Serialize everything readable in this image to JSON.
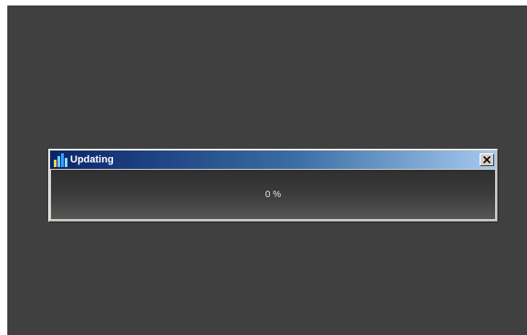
{
  "dialog": {
    "title": "Updating",
    "progress_text": "0 %",
    "progress": 0
  },
  "icons": {
    "app": "bar-chart-icon",
    "close": "close-icon"
  },
  "colors": {
    "backdrop": "#404040",
    "titlebar_start": "#0a246a",
    "titlebar_end": "#a6caf0",
    "content_bg": "#3b3b3b",
    "progress_text": "#e8e8e8"
  }
}
